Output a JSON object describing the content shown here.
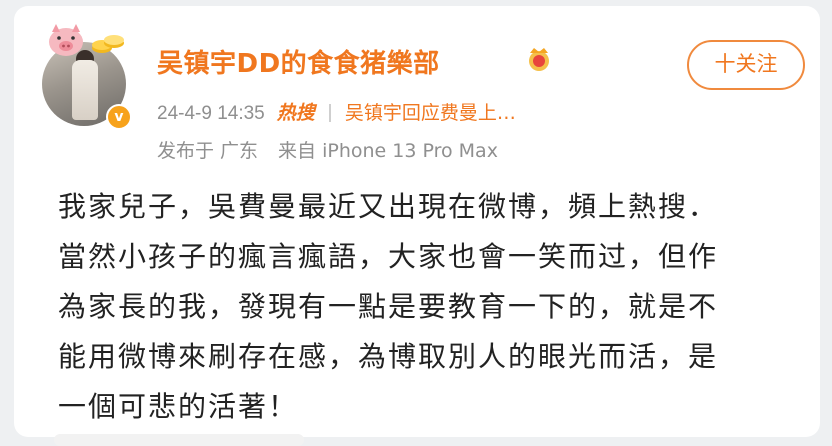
{
  "post": {
    "username": "吴镇宇DD的食食猪樂部",
    "follow_label": "十关注",
    "time": "24-4-9 14:35",
    "hot_label": "热搜",
    "topic": "吴镇宇回应费曼上…",
    "location": "发布于 广东",
    "device": "来自 iPhone 13 Pro Max",
    "lines": [
      "我家兒子，吳費曼最近又出現在微博，頻上熱搜．",
      "當然小孩子的瘋言瘋語，大家也會一笑而过，但作",
      "為家長的我，發現有一點是要教育一下的，就是不",
      "能用微博來刷存在感，為博取別人的眼光而活，是",
      "一個可悲的活著！"
    ]
  },
  "icons": {
    "avatar_badge": "pig-icon",
    "coins": "coins-icon",
    "verified": "verified-icon",
    "member": "crown-icon"
  },
  "colors": {
    "accent": "#f0771f",
    "meta": "#8f8f8f",
    "body_text": "#222222"
  }
}
